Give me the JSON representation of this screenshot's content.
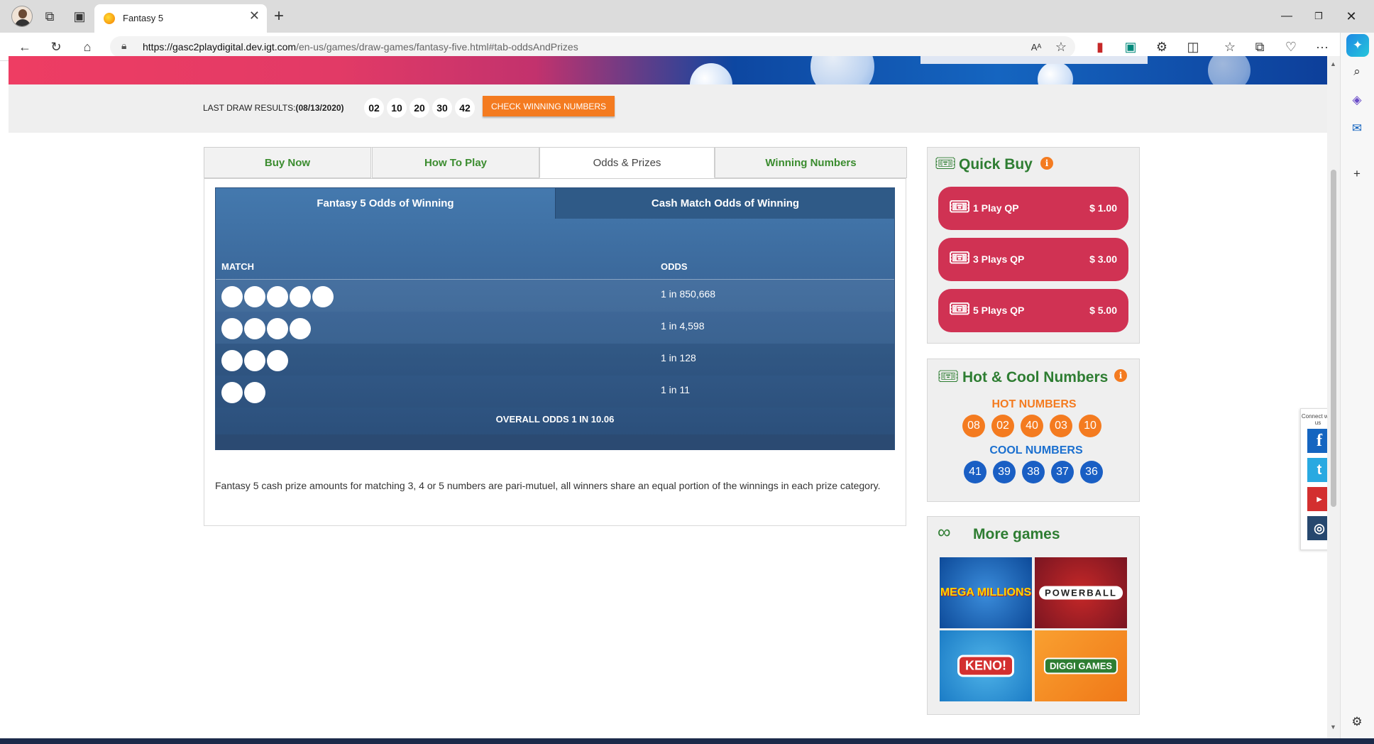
{
  "browser": {
    "tab_title": "Fantasy 5",
    "url_host": "https://gasc2playdigital.dev.igt.com",
    "url_path": "/en-us/games/draw-games/fantasy-five.html#tab-oddsAndPrizes"
  },
  "draw": {
    "label": "LAST DRAW RESULTS:",
    "date": "(08/13/2020)",
    "numbers": [
      "02",
      "10",
      "20",
      "30",
      "42"
    ],
    "check_button": "CHECK WINNING NUMBERS"
  },
  "tabs": {
    "buy_now": "Buy Now",
    "how_to_play": "How To Play",
    "odds_prizes": "Odds & Prizes",
    "winning_numbers": "Winning Numbers"
  },
  "odds": {
    "subtab_f5": "Fantasy 5 Odds of Winning",
    "subtab_cash": "Cash Match Odds of Winning",
    "col_match": "MATCH",
    "col_odds": "ODDS",
    "rows": [
      {
        "balls": 5,
        "odds": "1 in 850,668"
      },
      {
        "balls": 4,
        "odds": "1 in 4,598"
      },
      {
        "balls": 3,
        "odds": "1 in 128"
      },
      {
        "balls": 2,
        "odds": "1 in 11"
      }
    ],
    "overall": "OVERALL ODDS 1 IN 10.06",
    "footnote": "Fantasy 5 cash prize amounts for matching 3, 4 or 5 numbers are pari-mutuel, all winners share an equal portion of the winnings in each prize category."
  },
  "quick_buy": {
    "title": "Quick Buy",
    "items": [
      {
        "label": "1 Play QP",
        "price": "$ 1.00"
      },
      {
        "label": "3 Plays QP",
        "price": "$ 3.00"
      },
      {
        "label": "5 Plays QP",
        "price": "$ 5.00"
      }
    ]
  },
  "hot_cool": {
    "title": "Hot & Cool Numbers",
    "hot_label": "HOT NUMBERS",
    "hot": [
      "08",
      "02",
      "40",
      "03",
      "10"
    ],
    "cool_label": "COOL NUMBERS",
    "cool": [
      "41",
      "39",
      "38",
      "37",
      "36"
    ]
  },
  "more_games": {
    "title": "More games",
    "games": [
      "MEGA MILLIONS",
      "POWERBALL",
      "KENO!",
      "DIGGI GAMES"
    ]
  },
  "social": {
    "label": "Connect with us",
    "networks": [
      "facebook",
      "twitter",
      "youtube",
      "instagram"
    ]
  },
  "colors": {
    "accent_green": "#2e7d32",
    "brand_red": "#d03253",
    "orange": "#f47b20",
    "odds_blue": "#3a6698"
  }
}
